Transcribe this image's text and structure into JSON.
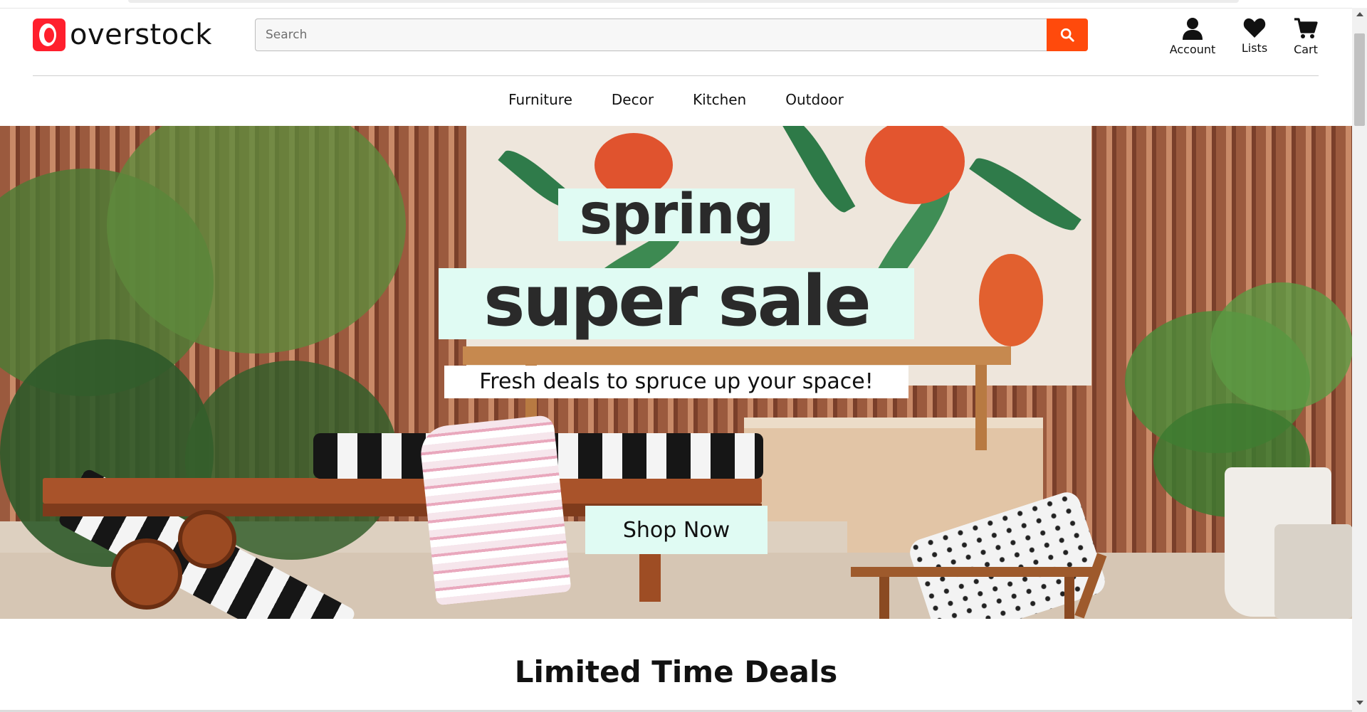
{
  "brand": {
    "name": "overstock",
    "logo_icon": "overstock-o-logo",
    "accent": "#ff1f2d"
  },
  "search": {
    "placeholder": "Search",
    "value": "",
    "button_icon": "search-icon",
    "button_color": "#ff4a0c"
  },
  "header_actions": [
    {
      "label": "Account",
      "icon": "person-icon"
    },
    {
      "label": "Lists",
      "icon": "heart-icon"
    },
    {
      "label": "Cart",
      "icon": "cart-icon"
    }
  ],
  "nav": {
    "items": [
      "Furniture",
      "Decor",
      "Kitchen",
      "Outdoor"
    ]
  },
  "hero": {
    "line1": "spring",
    "line2": "super sale",
    "tagline": "Fresh deals to spruce up your space!",
    "cta": "Shop Now",
    "highlight_color": "#e0fbf3"
  },
  "sections": {
    "deals_title": "Limited Time Deals"
  }
}
